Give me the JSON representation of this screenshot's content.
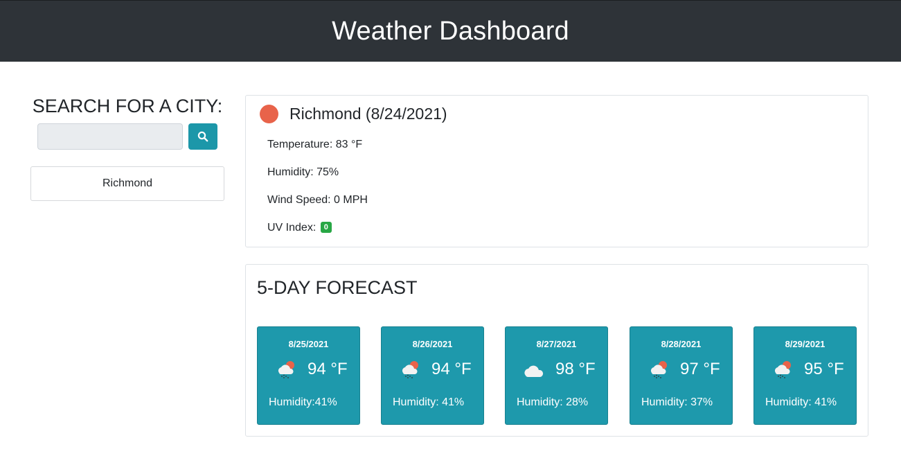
{
  "header": {
    "title": "Weather Dashboard"
  },
  "search": {
    "title": "SEARCH FOR A CITY:",
    "input_value": "",
    "button_icon": "search-icon"
  },
  "history": [
    "Richmond"
  ],
  "current": {
    "icon": "sun-icon",
    "title": "Richmond (8/24/2021)",
    "temperature": "Temperature: 83 °F",
    "humidity": "Humidity: 75%",
    "wind": "Wind Speed: 0 MPH",
    "uv_label": "UV Index:",
    "uv_value": "0",
    "uv_color": "#28a745"
  },
  "forecast": {
    "title": "5-DAY FORECAST",
    "days": [
      {
        "date": "8/25/2021",
        "icon": "rain-sun-icon",
        "temp": "94 °F",
        "humidity": "Humidity:41%"
      },
      {
        "date": "8/26/2021",
        "icon": "rain-sun-icon",
        "temp": "94 °F",
        "humidity": "Humidity: 41%"
      },
      {
        "date": "8/27/2021",
        "icon": "cloud-icon",
        "temp": "98 °F",
        "humidity": "Humidity: 28%"
      },
      {
        "date": "8/28/2021",
        "icon": "rain-sun-icon",
        "temp": "97 °F",
        "humidity": "Humidity: 37%"
      },
      {
        "date": "8/29/2021",
        "icon": "rain-sun-icon",
        "temp": "95 °F",
        "humidity": "Humidity: 41%"
      }
    ]
  },
  "colors": {
    "header_bg": "#2e3338",
    "accent": "#1e99ac",
    "sun": "#e8634a"
  }
}
